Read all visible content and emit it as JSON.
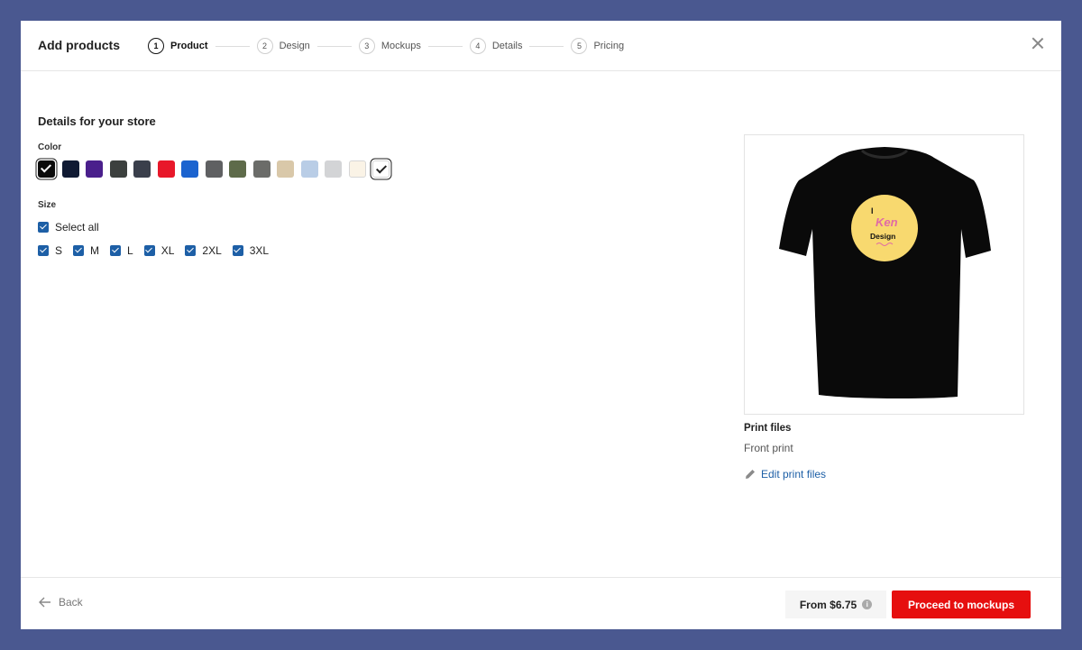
{
  "header": {
    "title": "Add products",
    "steps": [
      {
        "num": "1",
        "label": "Product"
      },
      {
        "num": "2",
        "label": "Design"
      },
      {
        "num": "3",
        "label": "Mockups"
      },
      {
        "num": "4",
        "label": "Details"
      },
      {
        "num": "5",
        "label": "Pricing"
      }
    ],
    "active_step": 1
  },
  "store": {
    "section_title": "Details for your store",
    "color_label": "Color",
    "colors": [
      "#0b0b0b",
      "#101a33",
      "#4a1f8c",
      "#3c403e",
      "#3a3f4b",
      "#e8182a",
      "#1b63cf",
      "#5f6062",
      "#5e6b4a",
      "#6b6c69",
      "#d9c8a9",
      "#b9cde6",
      "#d3d4d6",
      "#faf3e6",
      "#ffffff"
    ],
    "selected_colors": [
      0,
      14
    ],
    "size_label": "Size",
    "select_all_label": "Select all",
    "sizes": [
      "S",
      "M",
      "L",
      "XL",
      "2XL",
      "3XL"
    ]
  },
  "preview": {
    "design_text": [
      "I",
      "Ken",
      "Design"
    ],
    "print_files_title": "Print files",
    "print_files_sub": "Front print",
    "edit_label": "Edit print files"
  },
  "footer": {
    "back_label": "Back",
    "price_label": "From $6.75",
    "proceed_label": "Proceed to mockups"
  },
  "colors": {
    "accent": "#e60f0f",
    "link": "#1d5fa6",
    "backdrop": "#4a5890"
  }
}
